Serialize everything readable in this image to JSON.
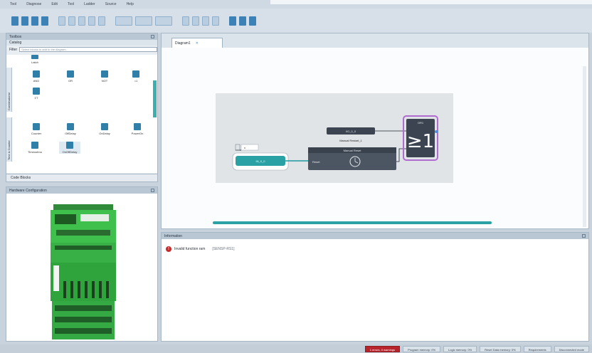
{
  "menu": [
    "Tool",
    "Diagnose",
    "Edit",
    "Tool",
    "Ladder",
    "Source",
    "Help"
  ],
  "toolbox": {
    "title": "Toolbox",
    "catalog": "Catalog",
    "filter_label": "Filter",
    "filter_placeholder": "Select blocks to add to the diagram",
    "top_block": "Latch",
    "tab_combinatorial": "Combinatorial",
    "tab_time_counter": "Time & Counter",
    "blocks_row1": [
      "AND",
      "OR",
      "NOT",
      "=1"
    ],
    "blocks_row2": [
      "ΣT"
    ],
    "blocks_row3": [
      "Counter",
      "OffDelay",
      "OnDelay",
      "PowerOn"
    ],
    "blocks_row4": [
      "Timeoutmo",
      "OnOffDelay"
    ],
    "code_blocks": "Code Blocks"
  },
  "hardware": {
    "title": "Hardware Configuration"
  },
  "diagram": {
    "tab_label": "Diagram1",
    "input_tag": "IN_0_0",
    "pin_label": "x",
    "element_tag": "I/O_0_0",
    "element_caption": "Manual Restart_1",
    "reset_block_title": "Manual Reset",
    "reset_port": "Reset",
    "or_block_header": "OR1",
    "or_symbol": "≥1"
  },
  "info": {
    "title": "Information",
    "messages": [
      {
        "text": "Invalid function ram",
        "detail": "[SENSP-RS1]"
      }
    ]
  },
  "status": {
    "errors": "1 errors, 0 warnings",
    "program": "Program memory: 0%",
    "logic": "Logic memory: 0%",
    "reset": "Reset Data memory: 0%",
    "requirements": "Requirements",
    "connection": "Disconnected mode"
  }
}
